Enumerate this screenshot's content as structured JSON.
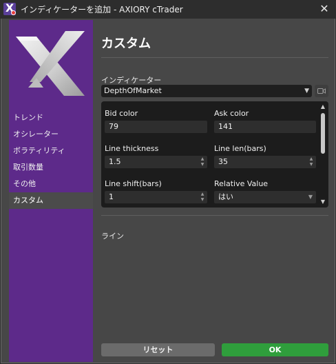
{
  "titlebar": {
    "title": "インディケーターを追加 - AXIORY cTrader",
    "close_glyph": "✕"
  },
  "colors": {
    "sidebar": "#5d2a8a",
    "ok_button": "#2f9e3c",
    "reset_button": "#6b6b6b",
    "panel_bg": "#474747",
    "params_bg": "#1c1c1c"
  },
  "sidebar": {
    "items": [
      {
        "label": "トレンド"
      },
      {
        "label": "オシレーター"
      },
      {
        "label": "ボラティリティ"
      },
      {
        "label": "取引数量"
      },
      {
        "label": "その他"
      },
      {
        "label": "カスタム",
        "active": true
      }
    ]
  },
  "main": {
    "heading": "カスタム",
    "indicator_label": "インディケーター",
    "indicator_value": "DepthOfMarket",
    "section_label": "ライン"
  },
  "params": {
    "bid_color": {
      "label": "Bid color",
      "value": "79"
    },
    "ask_color": {
      "label": "Ask color",
      "value": "141"
    },
    "line_thickness": {
      "label": "Line thickness",
      "value": "1.5"
    },
    "line_len": {
      "label": "Line len(bars)",
      "value": "35"
    },
    "line_shift": {
      "label": "Line shift(bars)",
      "value": "1"
    },
    "relative_value": {
      "label": "Relative Value",
      "value": "はい"
    }
  },
  "buttons": {
    "reset": "リセット",
    "ok": "OK"
  },
  "icons": {
    "app": "cTrader-app-icon",
    "close": "close-icon",
    "dropdown": "chevron-down-icon",
    "spinner": "spinner-arrows-icon",
    "video": "video-camera-icon"
  }
}
